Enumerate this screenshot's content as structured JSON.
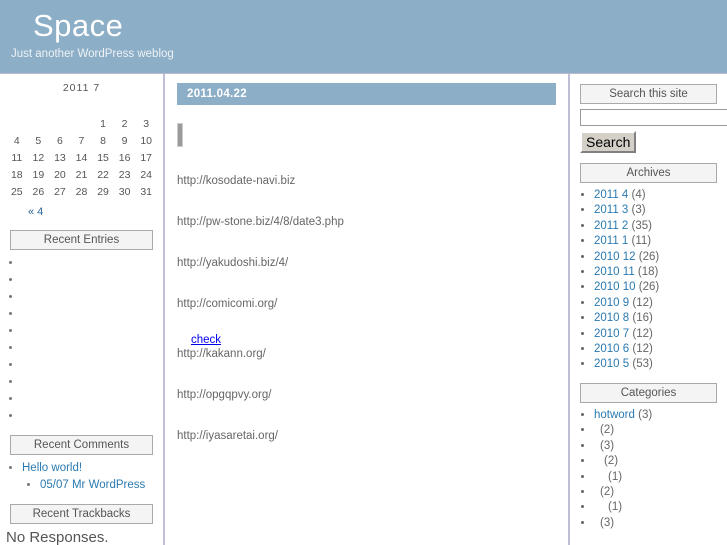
{
  "header": {
    "title": "Space",
    "tagline": "Just another WordPress weblog",
    "band_color": "#8caec6"
  },
  "sidebar_left": {
    "calendar": {
      "caption": "2011  7",
      "weekday_headers": [
        "",
        "",
        "",
        "",
        "",
        "",
        ""
      ],
      "weeks": [
        [
          "",
          "",
          "",
          "",
          "1",
          "2",
          "3"
        ],
        [
          "4",
          "5",
          "6",
          "7",
          "8",
          "9",
          "10"
        ],
        [
          "11",
          "12",
          "13",
          "14",
          "15",
          "16",
          "17"
        ],
        [
          "18",
          "19",
          "20",
          "21",
          "22",
          "23",
          "24"
        ],
        [
          "25",
          "26",
          "27",
          "28",
          "29",
          "30",
          "31"
        ]
      ],
      "prev_link": "« 4"
    },
    "recent_entries": {
      "heading": "Recent Entries",
      "items": [
        "",
        "",
        "",
        "",
        "",
        "",
        "",
        "",
        "",
        ""
      ]
    },
    "recent_comments": {
      "heading": "Recent Comments",
      "items": [
        {
          "label": "Hello world!",
          "sub": "05/07 Mr WordPress"
        }
      ]
    },
    "recent_trackbacks": {
      "heading": "Recent Trackbacks",
      "empty_text": "No Responses."
    }
  },
  "main": {
    "post_date": "2011.04.22",
    "links": [
      "http://kosodate-navi.biz",
      "http://pw-stone.biz/4/8/date3.php",
      "http://yakudoshi.biz/4/",
      "http://comicomi.org/"
    ],
    "check_label": "check",
    "links_after_check": [
      "http://kakann.org/",
      "http://opgqpvy.org/",
      "http://iyasaretai.org/"
    ]
  },
  "sidebar_right": {
    "search": {
      "heading": "Search this site",
      "input_value": "",
      "input_placeholder": "",
      "button_label": "Search"
    },
    "archives": {
      "heading": "Archives",
      "items": [
        {
          "label": "2011 4",
          "count": "(4)"
        },
        {
          "label": "2011 3",
          "count": "(3)"
        },
        {
          "label": "2011 2",
          "count": "(35)"
        },
        {
          "label": "2011 1",
          "count": "(11)"
        },
        {
          "label": "2010 12",
          "count": "(26)"
        },
        {
          "label": "2010 11",
          "count": "(18)"
        },
        {
          "label": "2010 10",
          "count": "(26)"
        },
        {
          "label": "2010 9",
          "count": "(12)"
        },
        {
          "label": "2010 8",
          "count": "(16)"
        },
        {
          "label": "2010 7",
          "count": "(12)"
        },
        {
          "label": "2010 6",
          "count": "(12)"
        },
        {
          "label": "2010 5",
          "count": "(53)"
        }
      ]
    },
    "categories": {
      "heading": "Categories",
      "items": [
        {
          "label": "hotword",
          "count": "(3)",
          "indent": 0
        },
        {
          "label": "",
          "count": "(2)",
          "indent": 1
        },
        {
          "label": "",
          "count": "(3)",
          "indent": 1
        },
        {
          "label": "",
          "count": "(2)",
          "indent": 2
        },
        {
          "label": "",
          "count": "(1)",
          "indent": 3
        },
        {
          "label": "",
          "count": "(2)",
          "indent": 1
        },
        {
          "label": "",
          "count": "(1)",
          "indent": 3
        },
        {
          "label": "",
          "count": "(3)",
          "indent": 1
        }
      ]
    }
  }
}
